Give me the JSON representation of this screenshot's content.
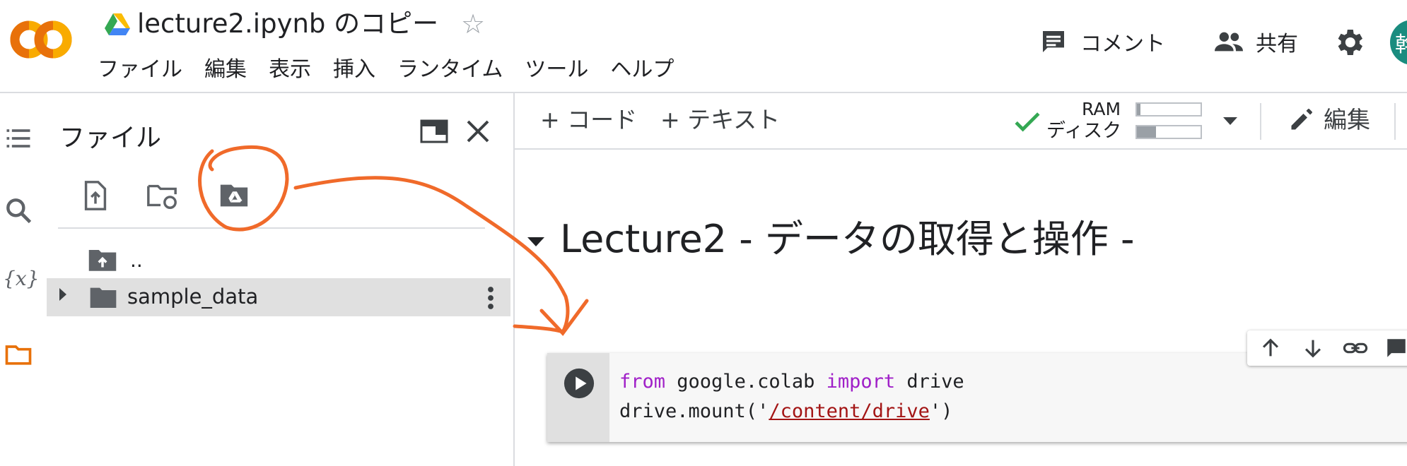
{
  "header": {
    "logo_text": "CO",
    "notebook_title": "lecture2.ipynb のコピー",
    "menu": [
      "ファイル",
      "編集",
      "表示",
      "挿入",
      "ランタイム",
      "ツール",
      "ヘルプ"
    ],
    "comment_label": "コメント",
    "share_label": "共有",
    "avatar_letter": "幹"
  },
  "file_panel": {
    "title": "ファイル",
    "parent_dir": "..",
    "items": [
      {
        "name": "sample_data"
      }
    ]
  },
  "notebook_toolbar": {
    "add_code": "+ コード",
    "add_text": "+ テキスト",
    "ram_label": "RAM",
    "disk_label": "ディスク",
    "ram_usage": 0.05,
    "disk_usage": 0.3,
    "edit_label": "編集"
  },
  "notebook": {
    "section_heading": "Lecture2 - データの取得と操作 -",
    "code": {
      "kw_from": "from",
      "module": " google.colab ",
      "kw_import": "import",
      "name": " drive",
      "mount_prefix": "drive.mount('",
      "mount_path": "/content/drive",
      "mount_suffix": "')"
    }
  },
  "colors": {
    "accent_orange": "#f9ab00",
    "accent_orange_dark": "#e8710a",
    "annotation": "#f06a2a",
    "connected_check": "#34a853",
    "keyword": "#a020c8",
    "string": "#a31515",
    "avatar": "#1a8c7f"
  }
}
